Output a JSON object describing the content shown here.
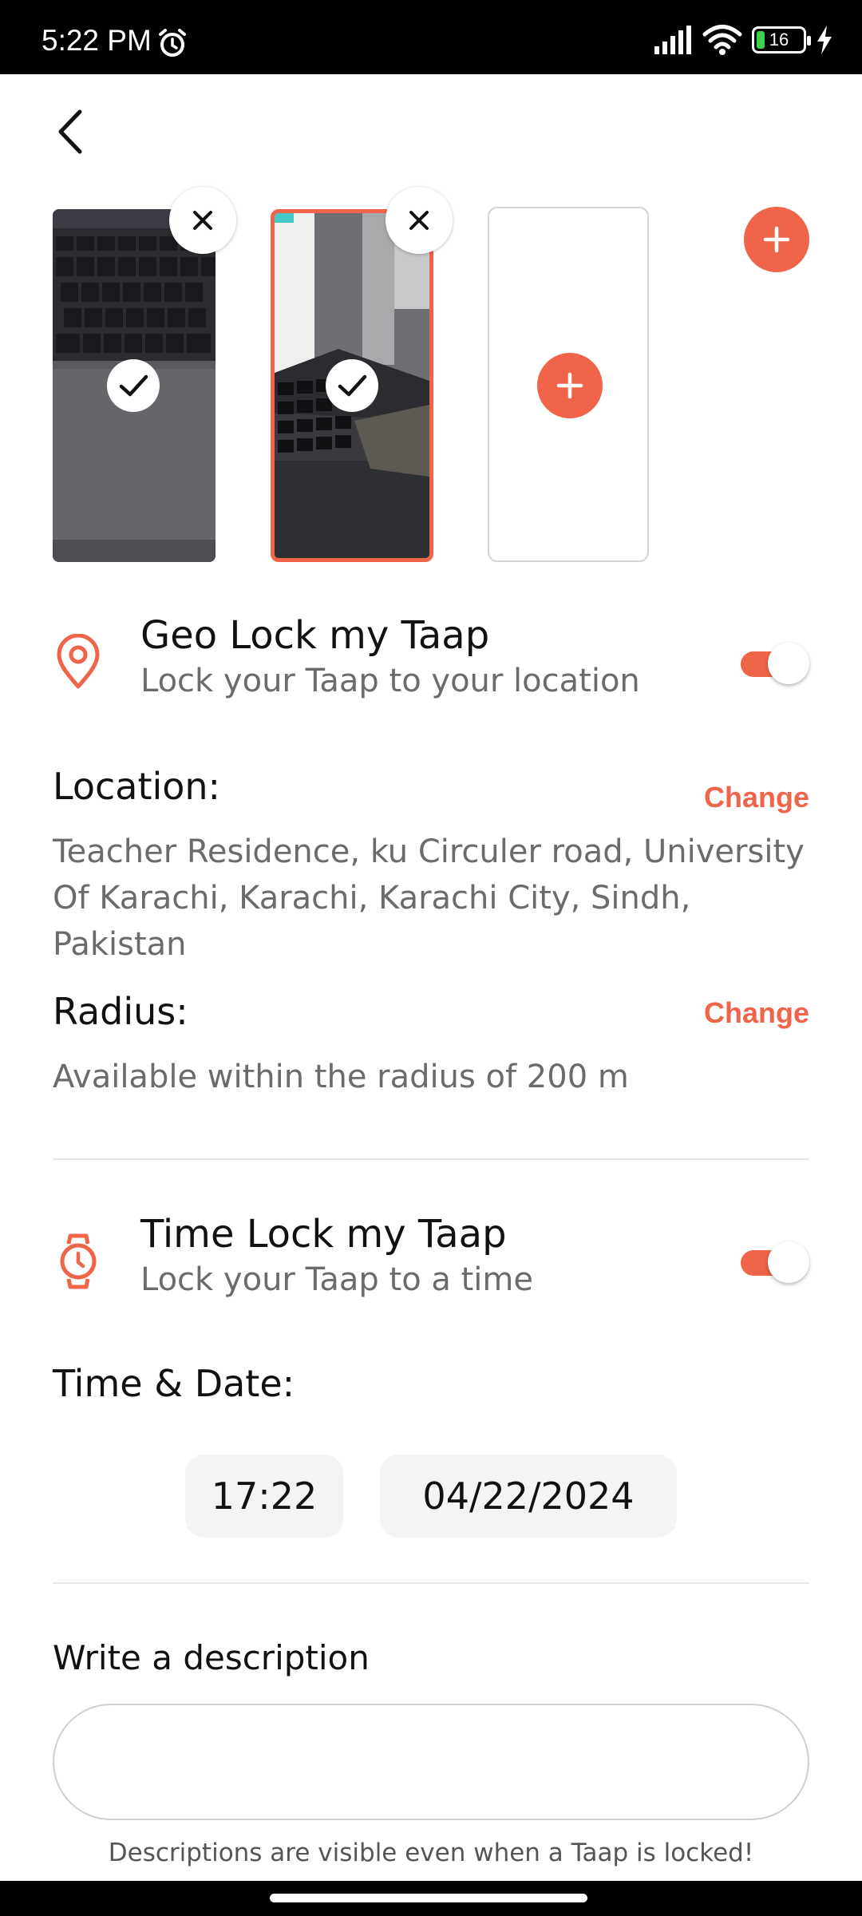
{
  "status_bar": {
    "time": "5:22 PM",
    "battery_level": "16"
  },
  "photos": [
    {
      "selected": true,
      "remove_label": "×"
    },
    {
      "selected": true,
      "remove_label": "×",
      "highlighted": true
    }
  ],
  "geo_lock": {
    "title": "Geo Lock my Taap",
    "subtitle": "Lock your Taap to your location",
    "enabled": true
  },
  "location": {
    "label": "Location:",
    "change_label": "Change",
    "address": "Teacher Residence, ku Circuler road, University Of Karachi, Karachi, Karachi City, Sindh, Pakistan"
  },
  "radius": {
    "label": "Radius:",
    "change_label": "Change",
    "text": "Available within the radius of 200 m"
  },
  "time_lock": {
    "title": "Time Lock my Taap",
    "subtitle": "Lock your Taap to a time",
    "enabled": true
  },
  "time_date": {
    "label": "Time & Date:",
    "time": "17:22",
    "date": "04/22/2024"
  },
  "description": {
    "label": "Write a description",
    "value": "",
    "note": "Descriptions are visible even when a Taap is locked!"
  },
  "colors": {
    "accent": "#f06449",
    "muted_text": "#6b6b6b",
    "divider": "#e6e6e6"
  }
}
